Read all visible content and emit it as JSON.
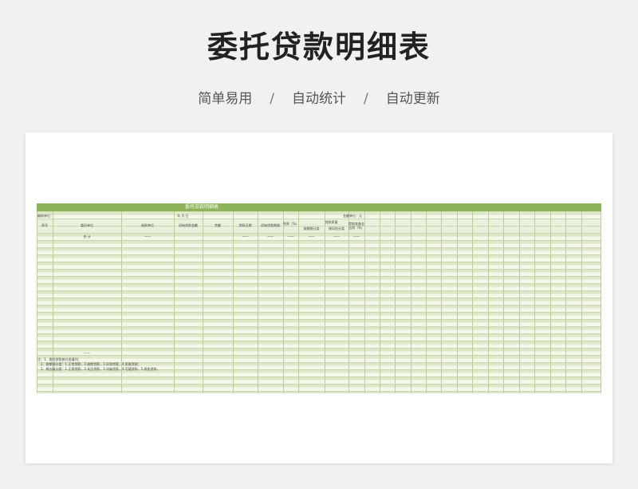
{
  "hero": {
    "title": "委托贷款明细表",
    "tags": [
      "简单易用",
      "自动统计",
      "自动更新"
    ],
    "separator": "/"
  },
  "sheet": {
    "title": "委托贷款明细表",
    "meta": {
      "unit_left": "编制单位：",
      "date": "年 月 日",
      "unit_right": "金额单位：元"
    },
    "headers": {
      "seq": "序号",
      "client": "委托单位",
      "borrower": "借款单位",
      "initial_amount": "初始贷款金额",
      "balance": "余额",
      "loan_date": "贷款日期",
      "term": "初始贷款期限",
      "rate": "利率（%）",
      "class_group": "贷款质量",
      "class_a": "按期限分类",
      "class_b": "按风险分类",
      "ratio": "提取准备金比例（%）"
    },
    "total_row": {
      "label": "合  计",
      "dash": "——"
    },
    "bottom_dash": "——",
    "notes": [
      "注：1、委托贷款按分类填列；",
      "2、按期限分类：1.正常贷款，2.逾期贷款，3.呆滞贷款，4.呆账贷款；",
      "3、按五级分类：1.正常贷款，2.关注贷款，3.次级贷款，4.可疑贷款，5.损失贷款。"
    ]
  }
}
